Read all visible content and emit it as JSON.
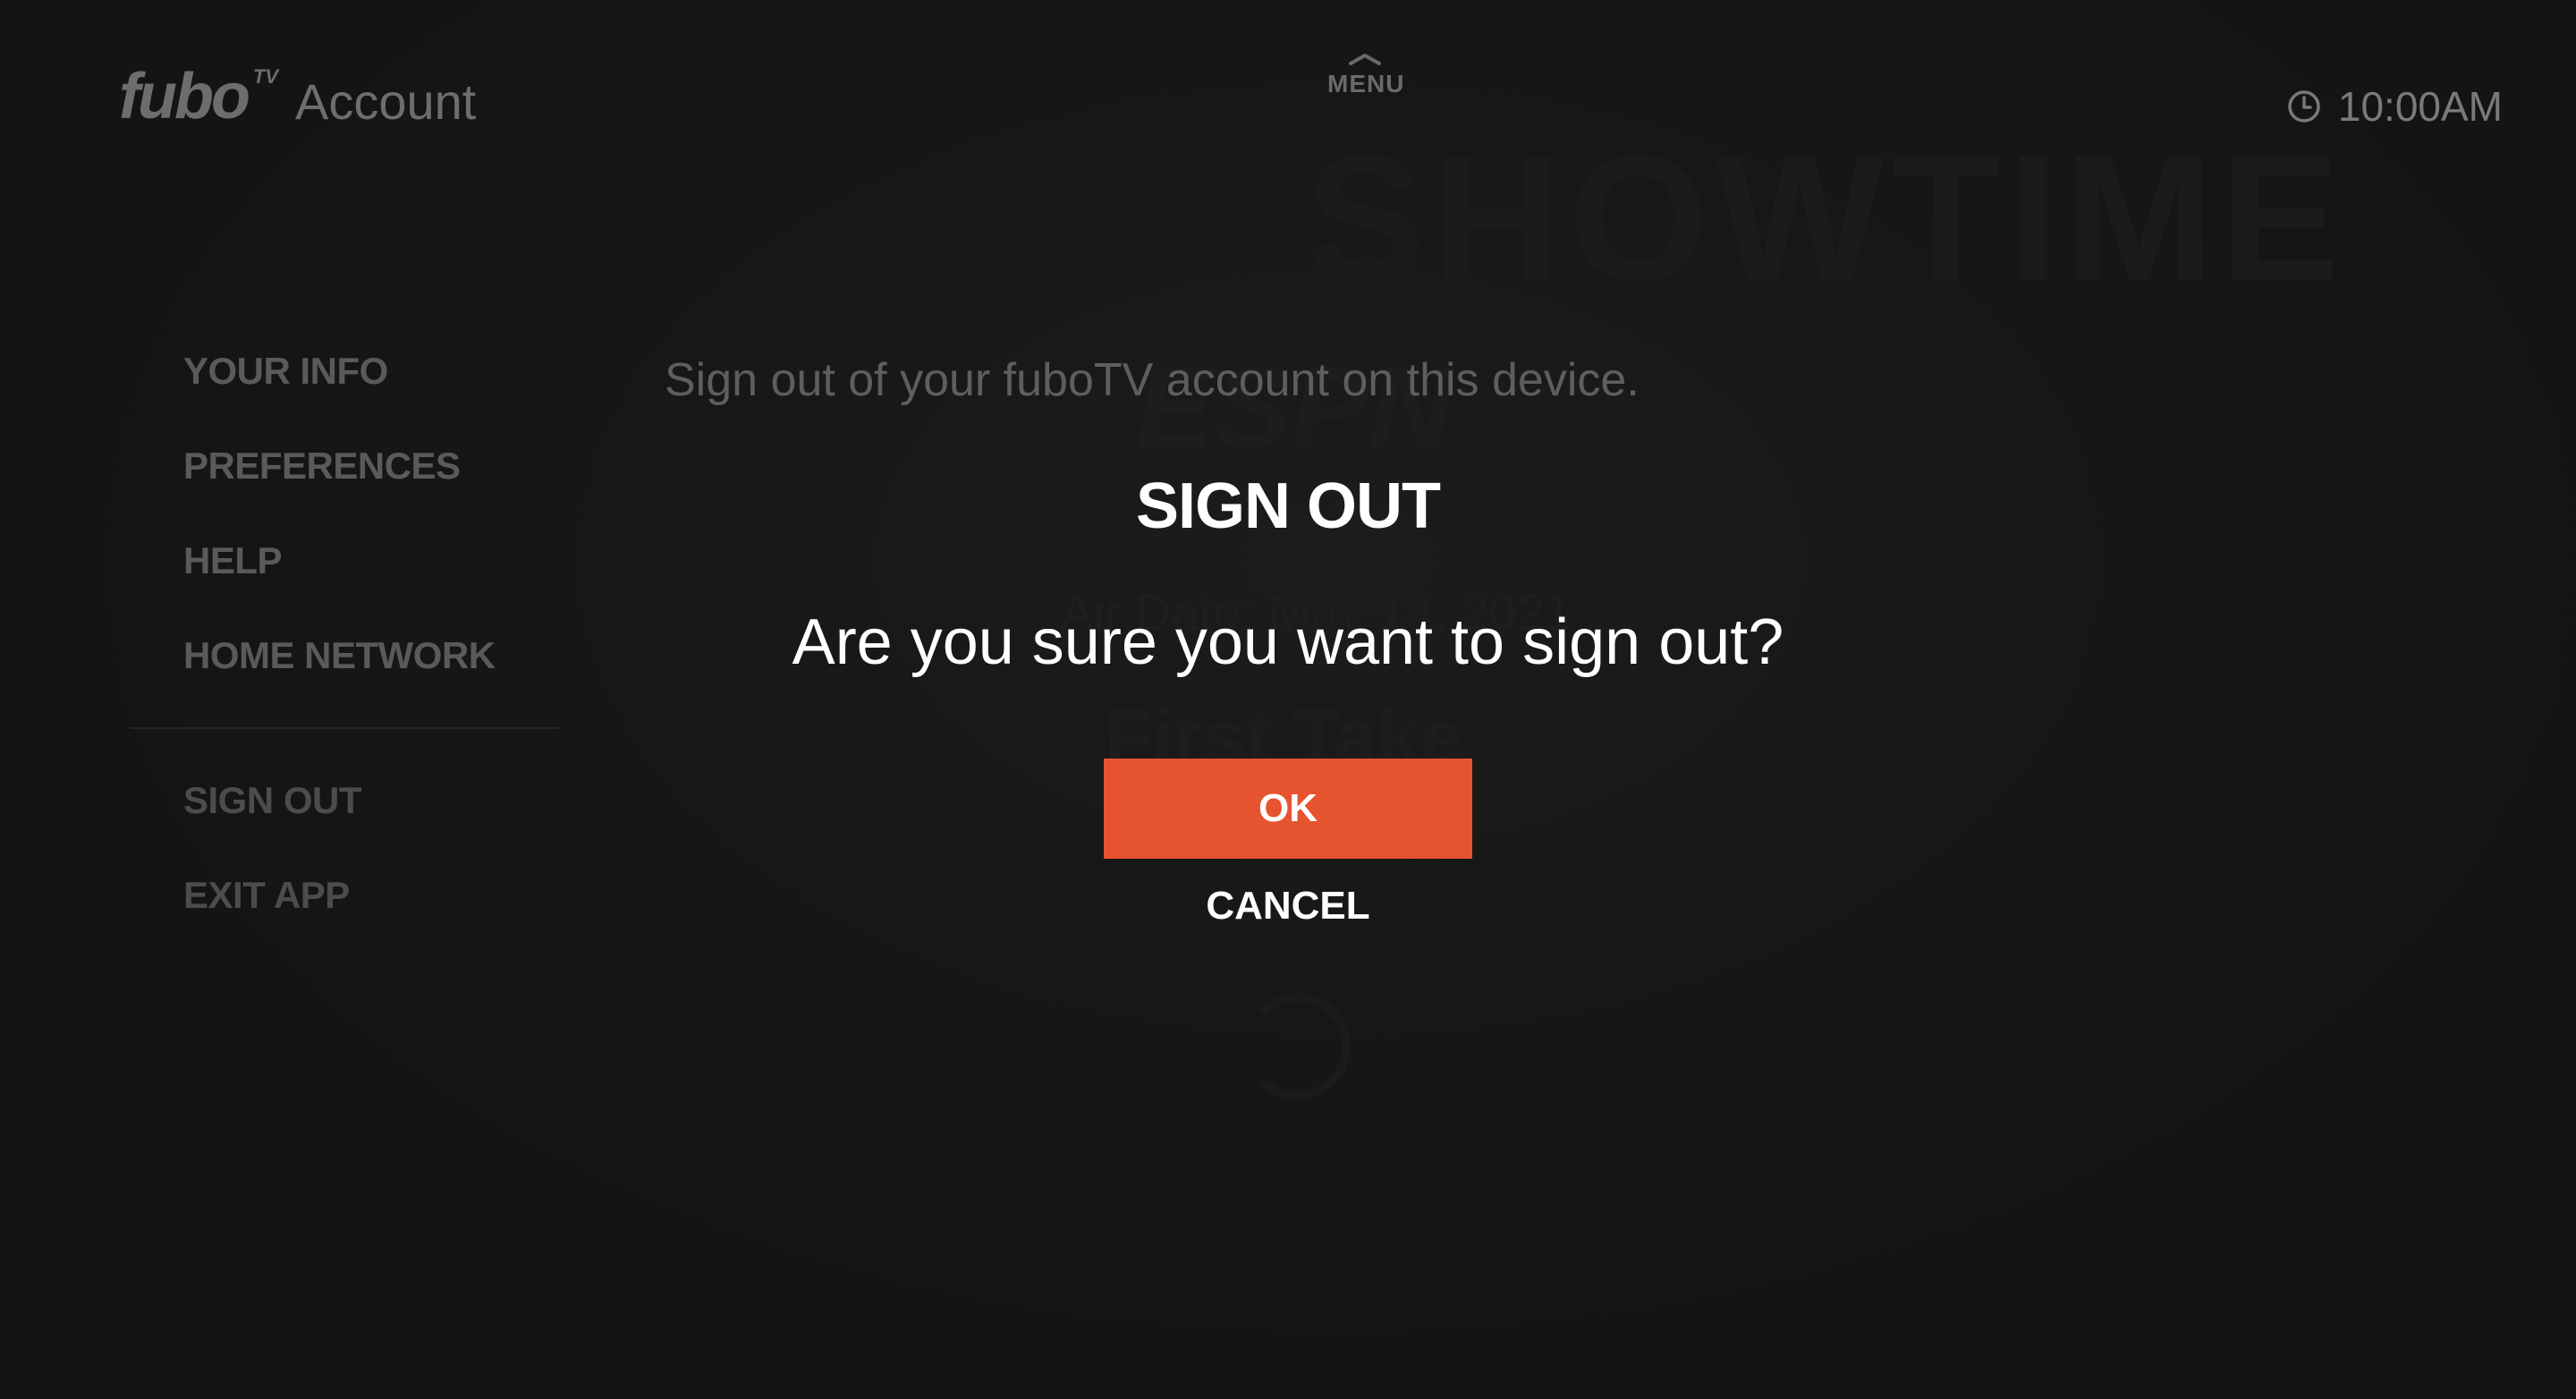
{
  "header": {
    "logo_text": "fubo",
    "logo_superscript": "TV",
    "section_title": "Account",
    "menu_label": "MENU",
    "menu_icon": "chevron-up-icon",
    "clock_icon": "clock-icon",
    "time": "10:00AM"
  },
  "sidebar": {
    "items": [
      {
        "label": "YOUR INFO"
      },
      {
        "label": "PREFERENCES"
      },
      {
        "label": "HELP"
      },
      {
        "label": "HOME NETWORK"
      }
    ],
    "secondary_items": [
      {
        "label": "SIGN OUT"
      },
      {
        "label": "EXIT APP"
      }
    ]
  },
  "main": {
    "description": "Sign out of your fuboTV account on this device."
  },
  "dialog": {
    "title": "SIGN OUT",
    "message": "Are you sure you want to sign out?",
    "ok_label": "OK",
    "cancel_label": "CANCEL"
  },
  "colors": {
    "background": "#141414",
    "accent": "#e6532f",
    "dialog_text": "#ffffff",
    "muted_text": "#5a5a5a"
  }
}
